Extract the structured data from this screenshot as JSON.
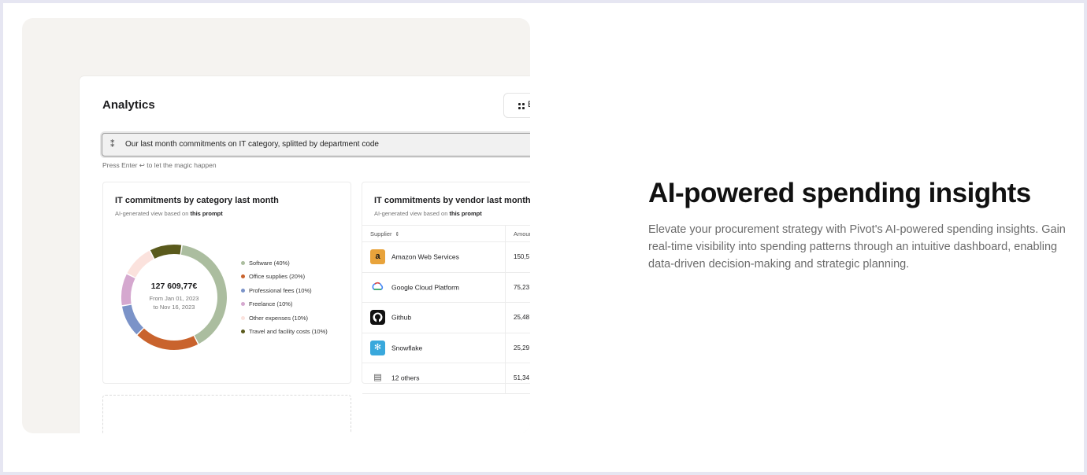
{
  "app": {
    "title": "Analytics",
    "top_button_label": "E",
    "search": {
      "value": "Our last month commitments on IT category, splitted by department code",
      "icon": "sparkle-icon"
    },
    "hint": "Press Enter ↩ to let the magic happen"
  },
  "category_card": {
    "title": "IT commitments by category last month",
    "subtitle_prefix": "AI-generated view based on",
    "subtitle_link": "this prompt",
    "total": "127 609,77€",
    "range_from": "From Jan 01, 2023",
    "range_to": "to Nov 16, 2023"
  },
  "chart_data": {
    "type": "pie",
    "variant": "donut",
    "categories": [
      "Software (40%)",
      "Office supplies (20%)",
      "Professional fees (10%)",
      "Freelance (10%)",
      "Other expenses (10%)",
      "Travel and facility costs (10%)"
    ],
    "values": [
      40,
      20,
      10,
      10,
      10,
      10
    ],
    "colors": [
      "#abbd9f",
      "#c9632d",
      "#7b93c8",
      "#d5a8cf",
      "#fbe2dd",
      "#5a5a1c"
    ],
    "legend_placement": "right"
  },
  "vendor_card": {
    "title": "IT commitments by vendor last month",
    "subtitle_prefix": "AI-generated view based on",
    "subtitle_link": "this prompt",
    "columns": [
      "Supplier",
      "Amoun"
    ],
    "rows": [
      {
        "name": "Amazon Web Services",
        "amount": "150,5",
        "icon": "amazon-icon"
      },
      {
        "name": "Google Cloud Platform",
        "amount": "75,23",
        "icon": "google-cloud-icon"
      },
      {
        "name": "Github",
        "amount": "25,48",
        "icon": "github-icon"
      },
      {
        "name": "Snowflake",
        "amount": "25,29",
        "icon": "snowflake-icon"
      },
      {
        "name": "12 others",
        "amount": "51,34",
        "icon": "building-icon"
      }
    ]
  },
  "hero": {
    "title": "AI-powered spending insights",
    "body": "Elevate your procurement strategy with Pivot's AI-powered spending insights. Gain real-time visibility into spending patterns through an intuitive dashboard, enabling data-driven decision-making and strategic planning."
  }
}
